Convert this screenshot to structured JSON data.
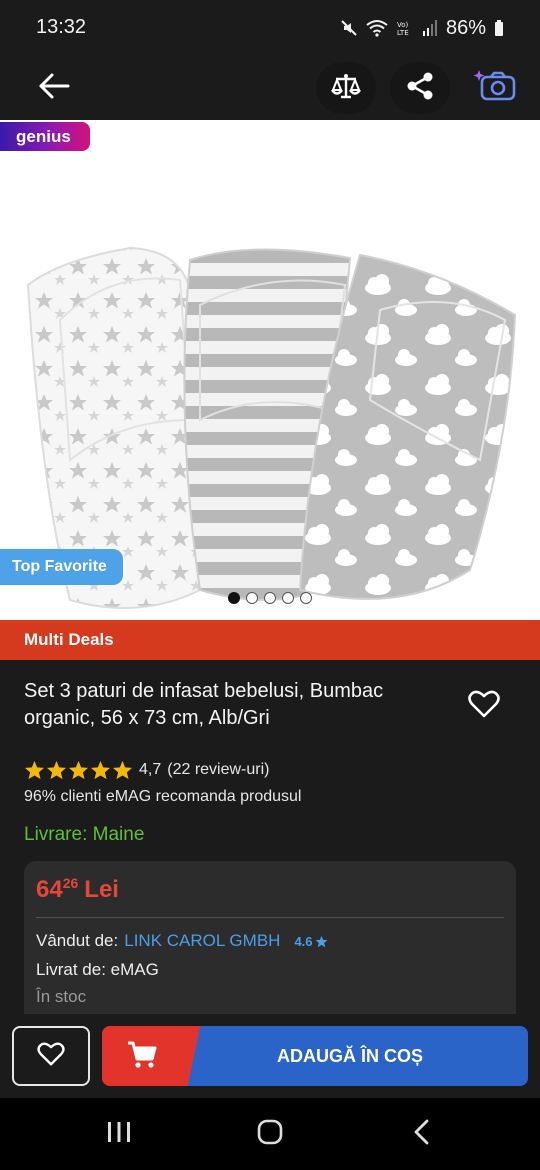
{
  "status_bar": {
    "time": "13:32",
    "battery": "86%",
    "icons": [
      "mute-icon",
      "wifi-icon",
      "volte-icon",
      "signal-icon",
      "battery-icon"
    ]
  },
  "app_bar": {
    "icons": [
      "back-arrow-icon",
      "compare-scale-icon",
      "share-icon",
      "camera-search-icon"
    ]
  },
  "product_image": {
    "genius_badge": "genius",
    "top_favorite_badge": "Top Favorite",
    "carousel": {
      "total": 5,
      "active_index": 0
    }
  },
  "deals_bar": {
    "label": "Multi Deals"
  },
  "product": {
    "title": "Set 3 paturi de infasat bebelusi, Bumbac organic, 56 x 73 cm, Alb/Gri",
    "rating_stars": 5,
    "rating": "4,7",
    "reviews": "(22 review-uri)",
    "recommendation": "96% clienti eMAG recomanda produsul",
    "delivery": "Livrare: Maine"
  },
  "offer": {
    "price_int": "64",
    "price_dec": "26",
    "currency": "Lei",
    "sold_by_label": "Vândut de:",
    "seller_name": "LINK CAROL GMBH",
    "seller_rating": "4.6",
    "shipped_by": "Livrat de: eMAG",
    "stock": "În stoc"
  },
  "actions": {
    "add_to_cart": "ADAUGĂ ÎN COȘ"
  },
  "nav": {
    "icons": [
      "recent-apps-icon",
      "home-icon",
      "back-nav-icon"
    ]
  },
  "colors": {
    "deals_red": "#d63a1e",
    "price_red": "#e8463a",
    "delivery_green": "#5fbf3a",
    "link_blue": "#4a9ee8",
    "cart_blue": "#2a64c8",
    "star_yellow": "#f5b800"
  }
}
